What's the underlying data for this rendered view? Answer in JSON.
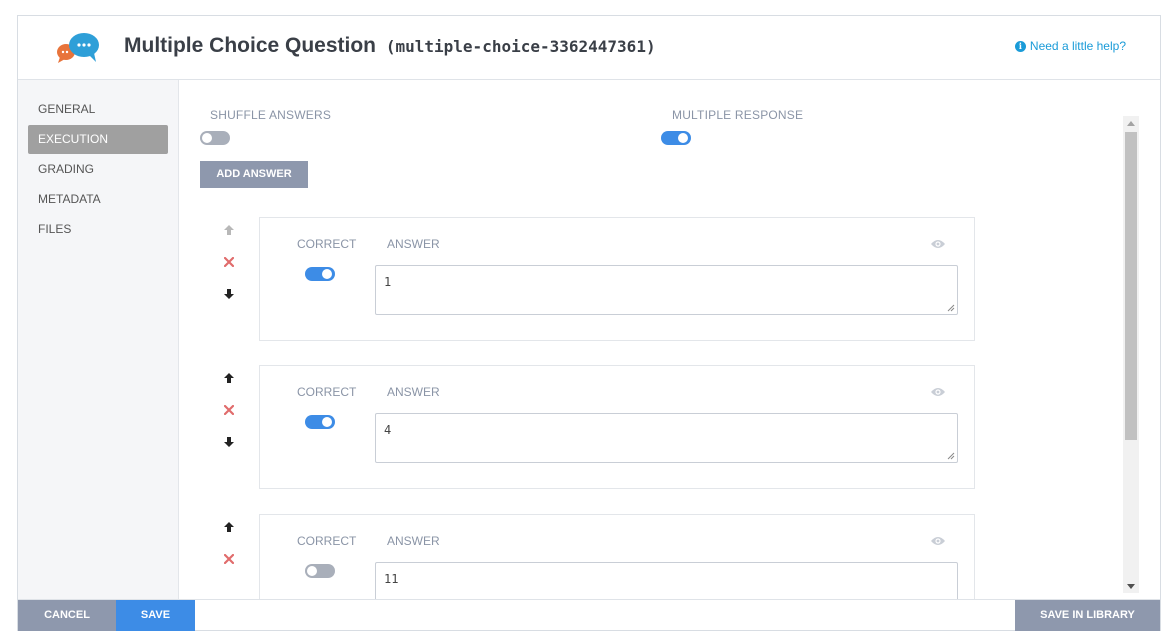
{
  "header": {
    "title": "Multiple Choice Question",
    "code": "(multiple-choice-3362447361)",
    "help_text": "Need a little help?"
  },
  "sidebar": {
    "items": [
      {
        "label": "GENERAL"
      },
      {
        "label": "EXECUTION"
      },
      {
        "label": "GRADING"
      },
      {
        "label": "METADATA"
      },
      {
        "label": "FILES"
      }
    ],
    "active": "EXECUTION"
  },
  "options": {
    "shuffle_label": "SHUFFLE ANSWERS",
    "shuffle_on": false,
    "multiple_label": "MULTIPLE RESPONSE",
    "multiple_on": true,
    "add_answer_label": "ADD ANSWER"
  },
  "answers": [
    {
      "correct_label": "CORRECT",
      "answer_label": "ANSWER",
      "correct": true,
      "value": "1"
    },
    {
      "correct_label": "CORRECT",
      "answer_label": "ANSWER",
      "correct": true,
      "value": "4"
    },
    {
      "correct_label": "CORRECT",
      "answer_label": "ANSWER",
      "correct": false,
      "value": "11"
    }
  ],
  "footer": {
    "cancel_label": "CANCEL",
    "save_label": "SAVE",
    "save_library_label": "SAVE IN LIBRARY"
  },
  "colors": {
    "accent_blue": "#3d8ce6",
    "button_gray": "#8e98ad",
    "active_nav": "#a0a0a0",
    "help_link": "#1a9bd8",
    "delete_red": "#e06c6c"
  }
}
